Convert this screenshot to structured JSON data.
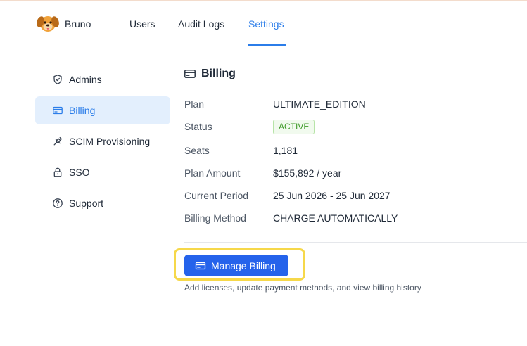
{
  "app": {
    "brand_name": "Bruno"
  },
  "nav": {
    "tabs": [
      {
        "label": "Users"
      },
      {
        "label": "Audit Logs"
      },
      {
        "label": "Settings",
        "active": true
      }
    ]
  },
  "sidebar": {
    "items": [
      {
        "label": "Admins",
        "icon": "shield-check-icon"
      },
      {
        "label": "Billing",
        "icon": "credit-card-icon",
        "active": true
      },
      {
        "label": "SCIM Provisioning",
        "icon": "plug-icon"
      },
      {
        "label": "SSO",
        "icon": "lock-icon"
      },
      {
        "label": "Support",
        "icon": "help-circle-icon"
      }
    ]
  },
  "billing": {
    "title": "Billing",
    "rows": [
      {
        "label": "Plan",
        "value": "ULTIMATE_EDITION"
      },
      {
        "label": "Status",
        "value": "ACTIVE"
      },
      {
        "label": "Seats",
        "value": "1,181"
      },
      {
        "label": "Plan Amount",
        "value": "$155,892 / year"
      },
      {
        "label": "Current Period",
        "value": "25 Jun 2026 - 25 Jun 2027"
      },
      {
        "label": "Billing Method",
        "value": "CHARGE AUTOMATICALLY"
      }
    ],
    "manage_button_label": "Manage Billing",
    "help_text": "Add licenses, update payment methods, and view billing history"
  },
  "colors": {
    "accent": "#2b7de9",
    "primary_button": "#2563eb",
    "active_badge_text": "#3e9a28",
    "highlight": "#f6d84a"
  }
}
